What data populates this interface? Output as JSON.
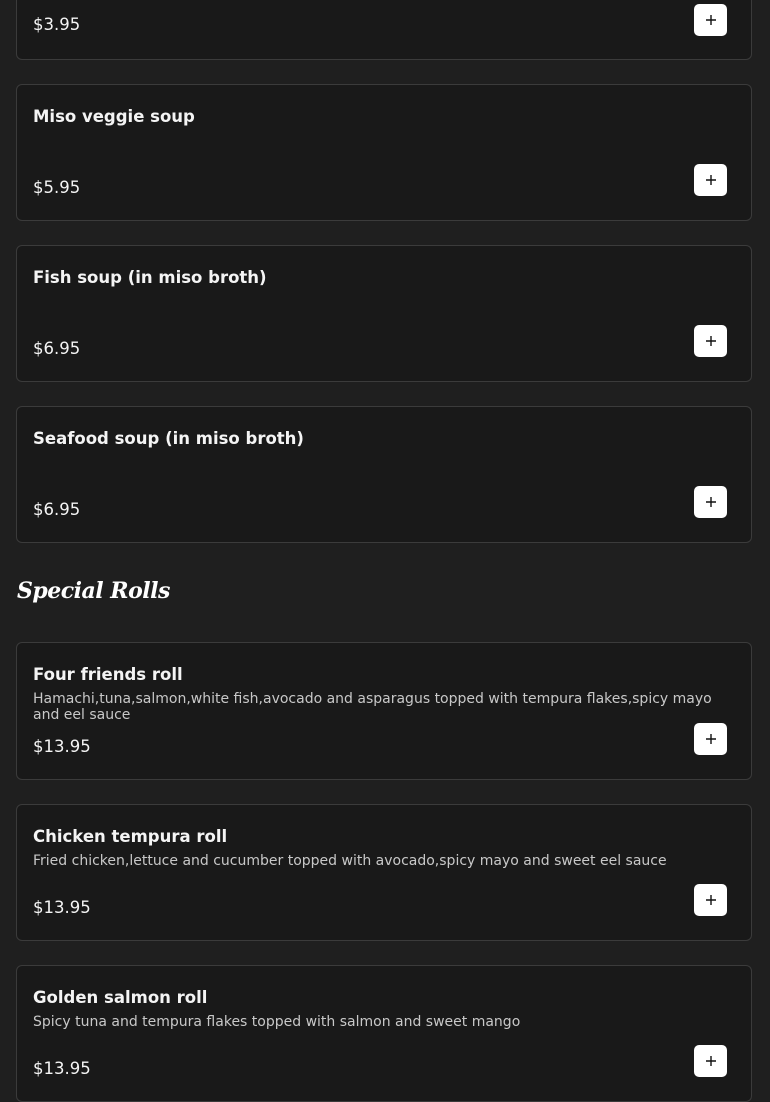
{
  "sections": [
    {
      "title": "",
      "items": [
        {
          "name": "",
          "description": "",
          "price": "$3.95",
          "add_icon": "plus-icon"
        },
        {
          "name": "Miso veggie soup",
          "description": "",
          "price": "$5.95",
          "add_icon": "plus-icon"
        },
        {
          "name": "Fish soup (in miso broth)",
          "description": "",
          "price": "$6.95",
          "add_icon": "plus-icon"
        },
        {
          "name": "Seafood soup (in miso broth)",
          "description": "",
          "price": "$6.95",
          "add_icon": "plus-icon"
        }
      ]
    },
    {
      "title": "Special Rolls",
      "items": [
        {
          "name": "Four friends roll",
          "description": "Hamachi,tuna,salmon,white fish,avocado and asparagus topped with tempura flakes,spicy mayo and eel sauce",
          "price": "$13.95",
          "add_icon": "plus-icon"
        },
        {
          "name": "Chicken tempura roll",
          "description": "Fried chicken,lettuce and cucumber topped with avocado,spicy mayo and sweet eel sauce",
          "price": "$13.95",
          "add_icon": "plus-icon"
        },
        {
          "name": "Golden salmon roll",
          "description": "Spicy tuna and tempura flakes topped with salmon and sweet mango",
          "price": "$13.95",
          "add_icon": "plus-icon"
        }
      ]
    }
  ],
  "colors": {
    "page_background": "#1f1f1f",
    "card_background": "#191919",
    "card_border": "#3b3b3b",
    "add_button": "#ffffff"
  }
}
